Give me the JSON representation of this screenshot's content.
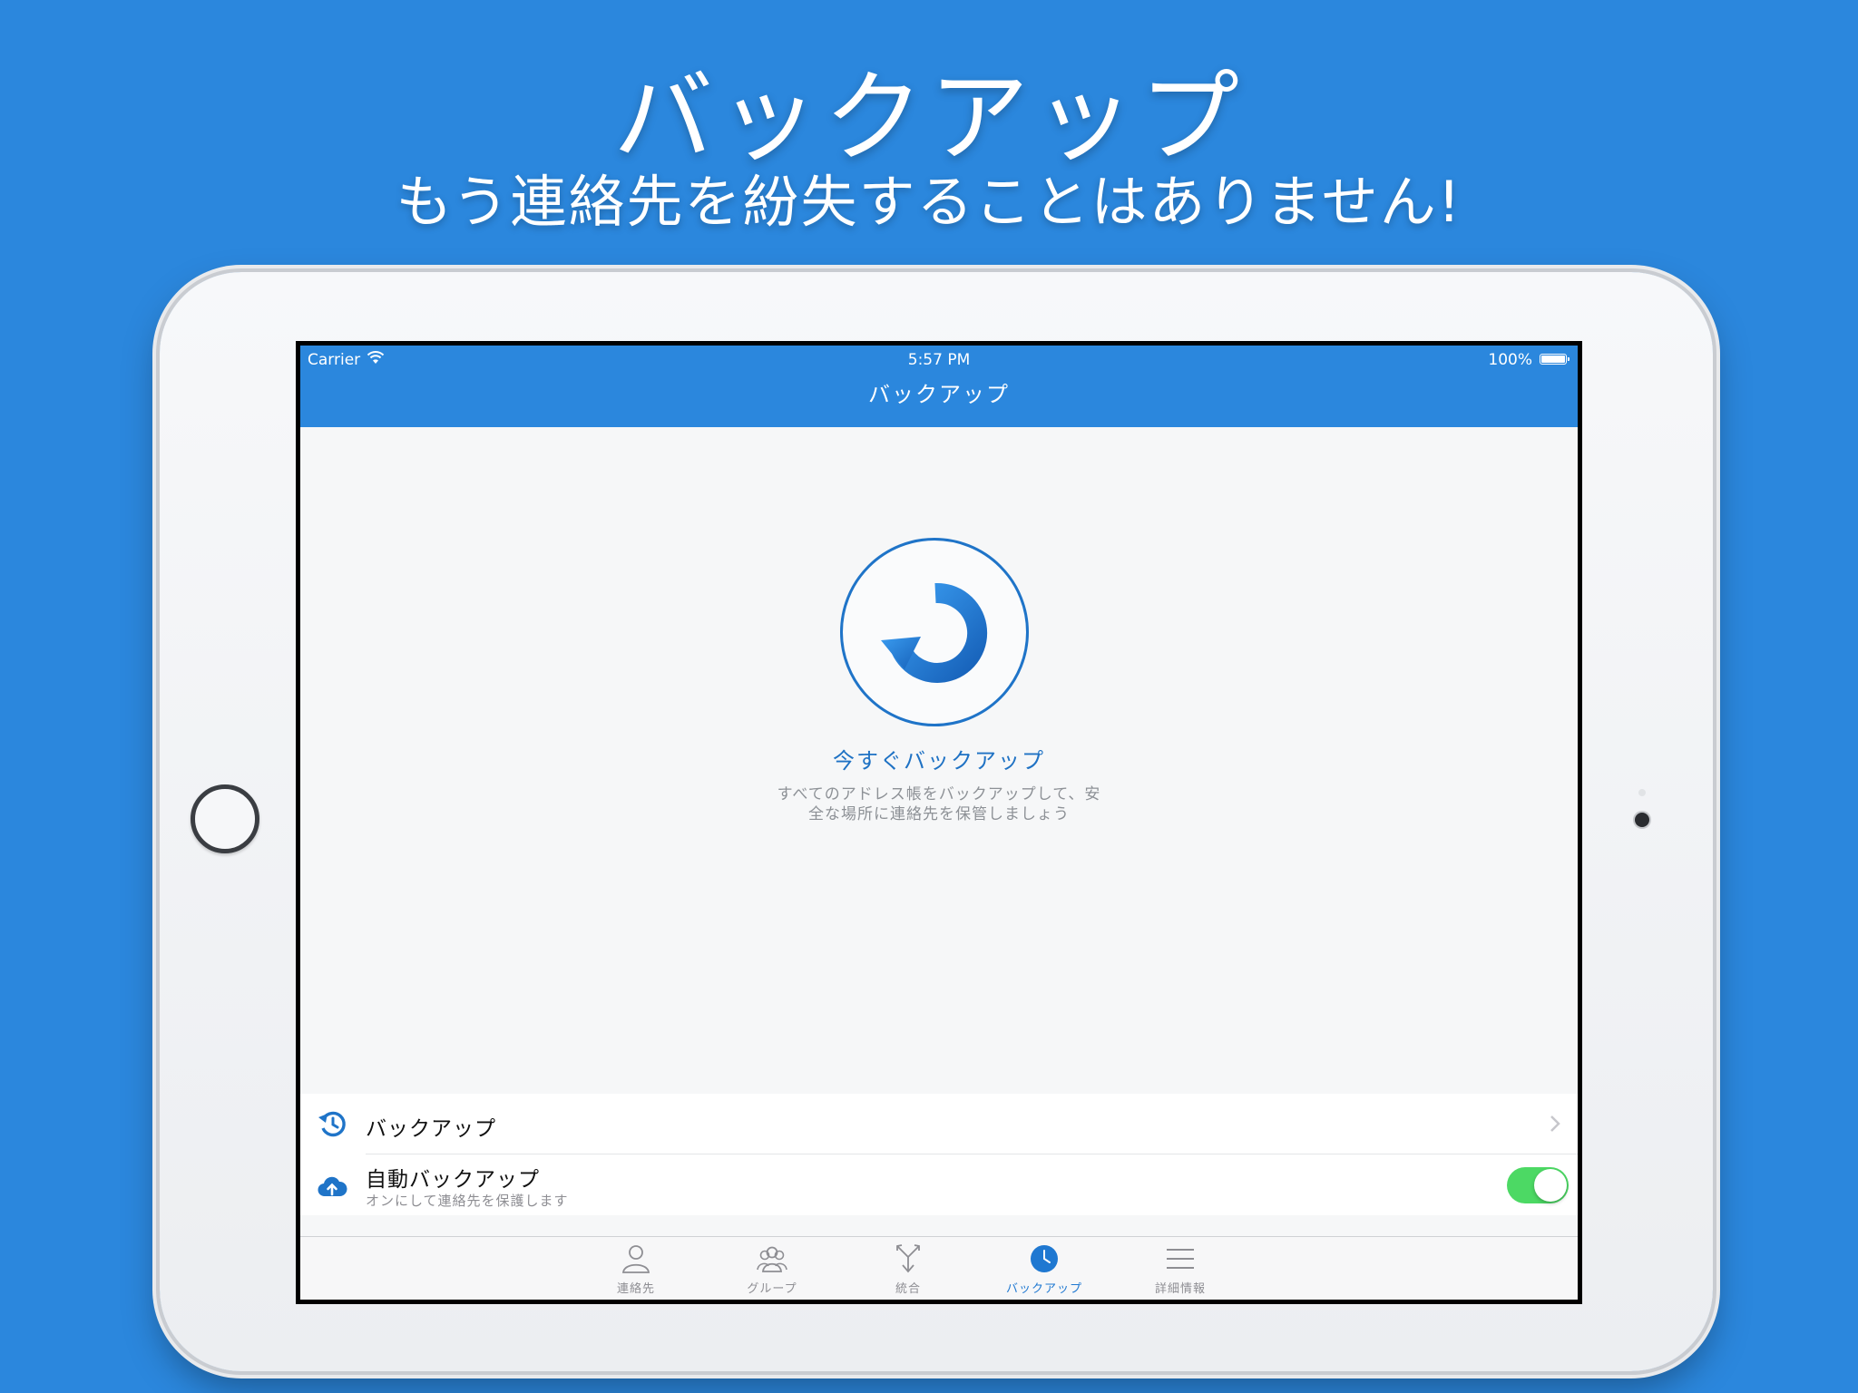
{
  "promo": {
    "headline": "バックアップ",
    "subheadline": "もう連絡先を紛失することはありません!"
  },
  "statusbar": {
    "carrier": "Carrier",
    "time": "5:57 PM",
    "battery": "100%"
  },
  "navbar": {
    "title": "バックアップ"
  },
  "backup_panel": {
    "action_label": "今すぐバックアップ",
    "description_line1": "すべてのアドレス帳をバックアップして、安",
    "description_line2": "全な場所に連絡先を保管しましょう"
  },
  "settings": {
    "backups_row": {
      "title": "バックアップ",
      "icon": "history-icon"
    },
    "auto_backup_row": {
      "title": "自動バックアップ",
      "subtitle": "オンにして連絡先を保護します",
      "icon": "cloud-upload-icon",
      "enabled": true
    }
  },
  "tabbar": {
    "tabs": [
      {
        "label": "連絡先",
        "icon": "person-icon",
        "active": false
      },
      {
        "label": "グループ",
        "icon": "group-icon",
        "active": false
      },
      {
        "label": "統合",
        "icon": "merge-icon",
        "active": false
      },
      {
        "label": "バックアップ",
        "icon": "clock-icon",
        "active": true
      },
      {
        "label": "詳細情報",
        "icon": "menu-icon",
        "active": false
      }
    ]
  },
  "colors": {
    "brand_blue": "#2b87dd",
    "accent_blue": "#1f72c4",
    "toggle_green": "#4cd964"
  }
}
